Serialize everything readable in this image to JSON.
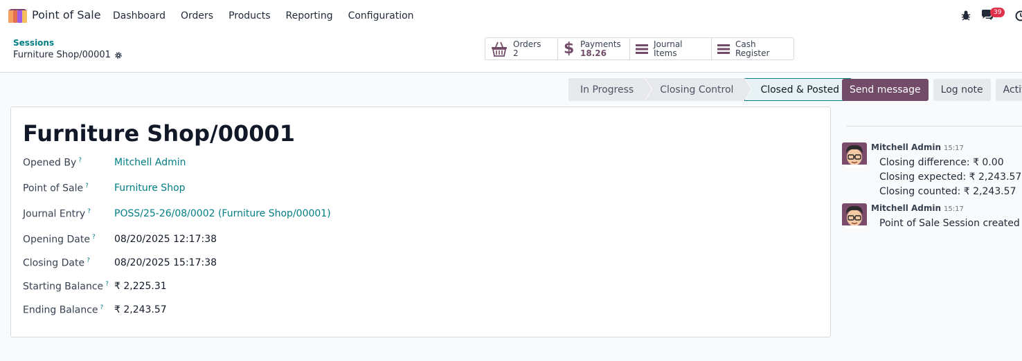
{
  "navbar": {
    "app_name": "Point of Sale",
    "menu": [
      "Dashboard",
      "Orders",
      "Products",
      "Reporting",
      "Configuration"
    ],
    "messages_count": "39"
  },
  "control": {
    "breadcrumb": "Sessions",
    "record_name": "Furniture Shop/00001",
    "smart_buttons": {
      "orders_label": "Orders",
      "orders_value": "2",
      "payments_label": "Payments",
      "payments_value": "18.26",
      "journal_items_label": "Journal Items",
      "cash_register_label": "Cash Register"
    }
  },
  "status": {
    "stages": [
      "In Progress",
      "Closing Control",
      "Closed & Posted"
    ],
    "current": "Closed & Posted"
  },
  "form": {
    "title": "Furniture Shop/00001",
    "fields": {
      "opened_by": {
        "label": "Opened By",
        "value": "Mitchell Admin"
      },
      "point_of_sale": {
        "label": "Point of Sale",
        "value": "Furniture Shop"
      },
      "journal_entry": {
        "label": "Journal Entry",
        "value": "POSS/25-26/08/0002 (Furniture Shop/00001)"
      },
      "opening_date": {
        "label": "Opening Date",
        "value": "08/20/2025 12:17:38"
      },
      "closing_date": {
        "label": "Closing Date",
        "value": "08/20/2025 15:17:38"
      },
      "starting_balance": {
        "label": "Starting Balance",
        "value": "₹ 2,225.31"
      },
      "ending_balance": {
        "label": "Ending Balance",
        "value": "₹ 2,243.57"
      }
    },
    "help_mark": "?"
  },
  "chatter": {
    "send_message": "Send message",
    "log_note": "Log note",
    "activities": "Activiti",
    "messages": [
      {
        "author": "Mitchell Admin",
        "time": "15:17",
        "lines": [
          "Closing difference: ₹ 0.00",
          "Closing expected: ₹ 2,243.57",
          "Closing counted: ₹ 2,243.57"
        ]
      },
      {
        "author": "Mitchell Admin",
        "time": "15:17",
        "lines": [
          "Point of Sale Session created"
        ]
      }
    ]
  },
  "colors": {
    "brand": "#714b67",
    "link": "#017e84",
    "badge": "#e0314b"
  }
}
